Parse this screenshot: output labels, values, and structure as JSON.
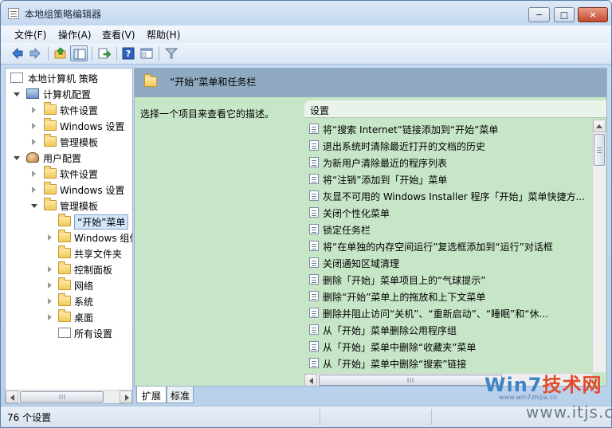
{
  "window": {
    "title": "本地组策略编辑器",
    "min_glyph": "─",
    "max_glyph": "□",
    "close_glyph": "✕"
  },
  "menu": [
    "文件(F)",
    "操作(A)",
    "查看(V)",
    "帮助(H)"
  ],
  "toolbar": [
    "back-arrow-icon",
    "forward-arrow-icon",
    "up-folder-icon",
    "show-hide-tree-icon",
    "export-list-icon",
    "help-icon",
    "properties-icon",
    "filter-icon"
  ],
  "tree": {
    "root": "本地计算机 策略",
    "computer": "计算机配置",
    "computer_children": [
      "软件设置",
      "Windows 设置",
      "管理模板"
    ],
    "user": "用户配置",
    "user_children": [
      "软件设置",
      "Windows 设置",
      "管理模板"
    ],
    "admin_children": [
      "“开始”菜单",
      "Windows 组件",
      "共享文件夹",
      "控制面板",
      "网络",
      "系统",
      "桌面",
      "所有设置"
    ]
  },
  "right": {
    "header_title": "“开始”菜单和任务栏",
    "description_hint": "选择一个项目来查看它的描述。",
    "column_header": "设置",
    "items": [
      "将“搜索 Internet”链接添加到“开始”菜单",
      "退出系统时清除最近打开的文档的历史",
      "为新用户清除最近的程序列表",
      "将“注销”添加到「开始」菜单",
      "灰显不可用的 Windows Installer 程序「开始」菜单快捷方...",
      "关闭个性化菜单",
      "锁定任务栏",
      "将“在单独的内存空间运行”复选框添加到“运行”对话框",
      "关闭通知区域清理",
      "删除「开始」菜单项目上的“气球提示”",
      "删除“开始”菜单上的拖放和上下文菜单",
      "删除并阻止访问“关机”、“重新启动”、“睡眠”和“休...",
      "从「开始」菜单删除公用程序组",
      "从「开始」菜单中删除“收藏夹”菜单",
      "从「开始」菜单中删除“搜索”链接"
    ]
  },
  "tabs": [
    "扩展",
    "标准"
  ],
  "status": {
    "text": "76 个设置"
  },
  "watermark": {
    "logo_a": "Win7",
    "logo_b": "技术网",
    "url_small": "www.win7zhijia.cn",
    "url_big": "www.itjs.cn"
  },
  "colors": {
    "list_bg": "#c7e6c7",
    "header_bg": "#8ea9c0",
    "chrome": "#c9dcf3"
  }
}
